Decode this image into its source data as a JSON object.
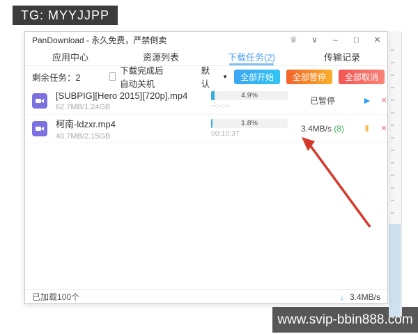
{
  "overlays": {
    "top_badge": "TG: MYYJJPP",
    "bottom_badge": "www.svip-bbin888.com"
  },
  "window": {
    "title": "PanDownload - 永久免费，严禁倒卖",
    "titlebar_icons": {
      "crown": "♕",
      "chevron_down": "∨",
      "minimize": "–",
      "maximize": "□",
      "close": "×"
    },
    "tabs": [
      {
        "label": "应用中心",
        "active": false
      },
      {
        "label": "资源列表",
        "active": false
      },
      {
        "label": "下载任务(2)",
        "active": true
      },
      {
        "label": "传输记录",
        "active": false
      }
    ],
    "toolbar": {
      "remaining_label": "剩余任务：2",
      "shutdown_checkbox_label": "下载完成后自动关机",
      "shutdown_checkbox_checked": false,
      "priority_dropdown_value": "默认",
      "dropdown_arrow": "▼",
      "start_all_label": "全部开始",
      "pause_all_label": "全部暂停",
      "cancel_all_label": "全部取消"
    },
    "tasks": [
      {
        "filename": "[SUBPIG][Hero 2015][720p].mp4",
        "size": "62.7MB/1.24GB",
        "progress_percent": "4.9%",
        "progress_value": 4.9,
        "time": "--:--:--",
        "status": "已暂停",
        "threads": "",
        "action": "play"
      },
      {
        "filename": "柯南-ldzxr.mp4",
        "size": "40.7MB/2.15GB",
        "progress_percent": "1.8%",
        "progress_value": 1.8,
        "time": "00:10:37",
        "status": "3.4MB/s",
        "threads": "(8)",
        "action": "pause"
      }
    ],
    "action_icons": {
      "play": "▶",
      "pause": "‖",
      "close": "×"
    },
    "statusbar": {
      "loaded_text": "已加载100个",
      "download_arrow": "↓",
      "speed_text": "3.4MB/s"
    }
  },
  "colors": {
    "accent_blue": "#4a9cf0",
    "btn_start": [
      "#3ba6f3",
      "#31c4f3"
    ],
    "btn_pause": [
      "#f4632c",
      "#f8b02a"
    ],
    "btn_cancel": [
      "#f25553",
      "#f8837a"
    ],
    "progress_fill": "#38aede",
    "file_icon_purple": "#7b72e0",
    "threads_green": "#3fae58",
    "annotation_arrow_red": "#d43a2b",
    "badge_bg_top": "#3c3c3c",
    "badge_bg_bottom": "#575757"
  }
}
